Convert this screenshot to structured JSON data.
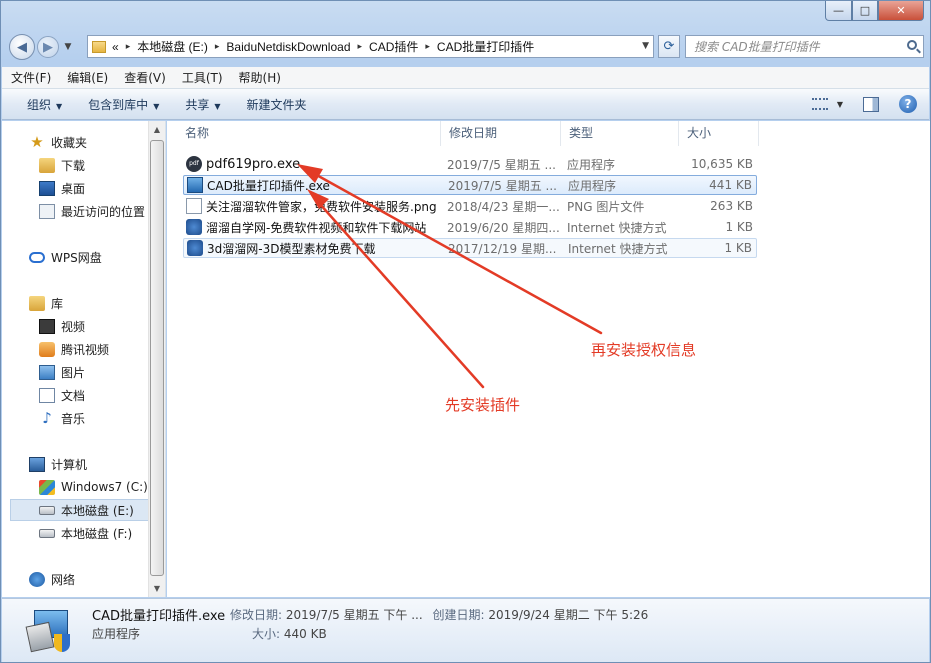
{
  "window": {
    "minimize_icon": "minimize-icon",
    "maximize_icon": "maximize-icon",
    "close_icon": "close-icon",
    "minimize_glyph": "—",
    "maximize_glyph": "□",
    "close_glyph": "✕"
  },
  "navigation": {
    "back_glyph": "◀",
    "forward_glyph": "▶",
    "dropdown_glyph": "▼",
    "address_prefix": "«",
    "breadcrumbs": [
      "本地磁盘 (E:)",
      "BaiduNetdiskDownload",
      "CAD插件",
      "CAD批量打印插件"
    ],
    "separator": "▸",
    "refresh_glyph": "⟳",
    "search_placeholder": "搜索 CAD批量打印插件"
  },
  "menubar": [
    "文件(F)",
    "编辑(E)",
    "查看(V)",
    "工具(T)",
    "帮助(H)"
  ],
  "toolbar": {
    "organize": "组织",
    "include_in_library": "包含到库中",
    "share": "共享",
    "new_folder": "新建文件夹",
    "help_glyph": "?"
  },
  "sidebar": {
    "items": [
      {
        "label": "收藏夹",
        "icon": "star-icon"
      },
      {
        "label": "下载",
        "icon": "downloads-folder-icon"
      },
      {
        "label": "桌面",
        "icon": "desktop-icon"
      },
      {
        "label": "最近访问的位置",
        "icon": "recent-places-icon"
      },
      {
        "label": "WPS网盘",
        "icon": "cloud-icon"
      },
      {
        "label": "库",
        "icon": "library-icon"
      },
      {
        "label": "视频",
        "icon": "video-icon"
      },
      {
        "label": "腾讯视频",
        "icon": "tencent-video-icon"
      },
      {
        "label": "图片",
        "icon": "pictures-icon"
      },
      {
        "label": "文档",
        "icon": "documents-icon"
      },
      {
        "label": "音乐",
        "icon": "music-icon"
      },
      {
        "label": "计算机",
        "icon": "computer-icon"
      },
      {
        "label": "Windows7 (C:)",
        "icon": "windows-drive-icon"
      },
      {
        "label": "本地磁盘 (E:)",
        "icon": "drive-icon",
        "selected": true
      },
      {
        "label": "本地磁盘 (F:)",
        "icon": "drive-icon"
      },
      {
        "label": "网络",
        "icon": "network-icon"
      }
    ],
    "scroll_up_glyph": "▲",
    "scroll_down_glyph": "▼",
    "music_glyph": "♪",
    "star_glyph": "★"
  },
  "columns": {
    "name": "名称",
    "date": "修改日期",
    "type": "类型",
    "size": "大小"
  },
  "files": [
    {
      "name": "pdf619pro.exe",
      "date": "2019/7/5 星期五 ...",
      "type": "应用程序",
      "size": "10,635 KB",
      "icon": "pdf-app-icon"
    },
    {
      "name": "CAD批量打印插件.exe",
      "date": "2019/7/5 星期五 ...",
      "type": "应用程序",
      "size": "441 KB",
      "icon": "installer-icon",
      "selected": true
    },
    {
      "name": "关注溜溜软件管家，免费软件安装服务.png",
      "date": "2018/4/23 星期一...",
      "type": "PNG 图片文件",
      "size": "263 KB",
      "icon": "png-file-icon"
    },
    {
      "name": "溜溜自学网-免费软件视频和软件下载网站",
      "date": "2019/6/20 星期四...",
      "type": "Internet 快捷方式",
      "size": "1 KB",
      "icon": "internet-shortcut-icon"
    },
    {
      "name": "3d溜溜网-3D模型素材免费下载",
      "date": "2017/12/19 星期...",
      "type": "Internet 快捷方式",
      "size": "1 KB",
      "icon": "internet-shortcut-icon",
      "hovered": true
    }
  ],
  "annotations": {
    "install_plugin_first": "先安装插件",
    "then_install_license": "再安装授权信息",
    "color": "#e33b26"
  },
  "details": {
    "name": "CAD批量打印插件.exe",
    "type": "应用程序",
    "modified_label": "修改日期:",
    "modified_value": "2019/7/5 星期五 下午 ...",
    "created_label": "创建日期:",
    "created_value": "2019/9/24 星期二 下午 5:26",
    "size_label": "大小:",
    "size_value": "440 KB"
  }
}
